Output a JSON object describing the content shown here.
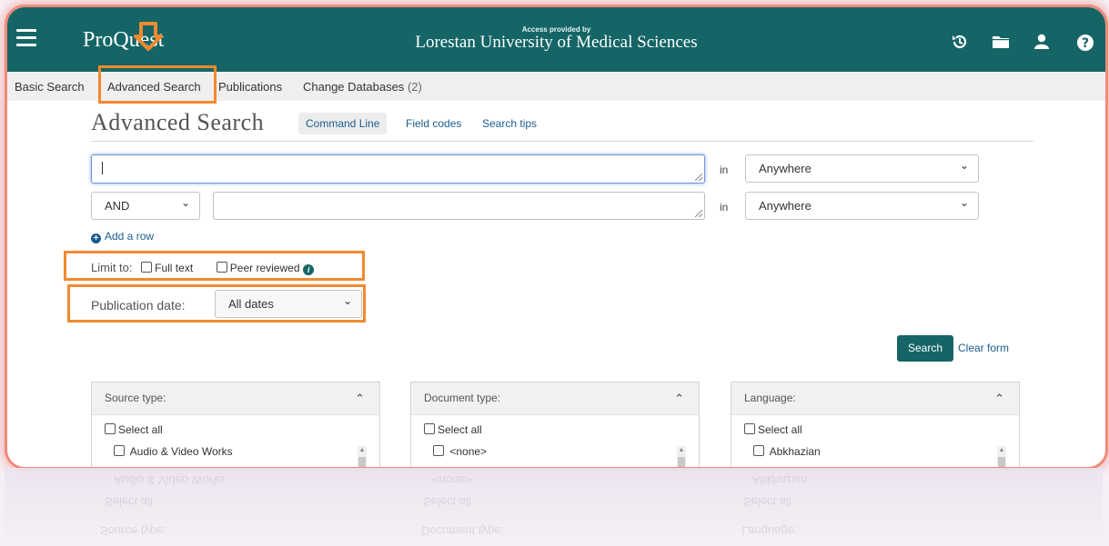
{
  "header": {
    "logo_text": "ProQuest",
    "access_small": "Access provided by",
    "access_institution": "Lorestan University of Medical Sciences",
    "icons": [
      "menu-icon",
      "history-icon",
      "folder-icon",
      "user-icon",
      "help-icon"
    ]
  },
  "tabs": {
    "basic": "Basic Search",
    "advanced": "Advanced Search",
    "publications": "Publications",
    "change_databases": "Change Databases",
    "change_databases_count": "(2)"
  },
  "main": {
    "title": "Advanced Search",
    "command_line": "Command Line",
    "field_codes": "Field codes",
    "search_tips": "Search tips"
  },
  "rows": [
    {
      "operator": null,
      "value": "",
      "in_label": "in",
      "field": "Anywhere"
    },
    {
      "operator": "AND",
      "value": "",
      "in_label": "in",
      "field": "Anywhere"
    }
  ],
  "add_row": "Add a row",
  "limit": {
    "label": "Limit to:",
    "full_text": "Full text",
    "peer_reviewed": "Peer reviewed"
  },
  "publication_date": {
    "label": "Publication date:",
    "value": "All dates"
  },
  "actions": {
    "search": "Search",
    "clear": "Clear form"
  },
  "filters": [
    {
      "title": "Source type:",
      "select_all": "Select all",
      "first_item": "Audio & Video Works"
    },
    {
      "title": "Document type:",
      "select_all": "Select all",
      "first_item": "<none>"
    },
    {
      "title": "Language:",
      "select_all": "Select all",
      "first_item": "Abkhazian"
    }
  ],
  "colors": {
    "brand": "#156566",
    "link": "#1a5e8f",
    "highlight": "#f28a2e",
    "frame": "#f08a7a"
  }
}
